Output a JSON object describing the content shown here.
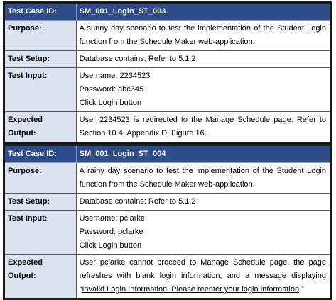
{
  "test_cases": [
    {
      "id_label": "Test Case ID:",
      "id_value": "SM_001_Login_ST_003",
      "purpose_label": "Purpose:",
      "purpose_value": "A sunny day scenario to test the implementation of the Student Login function from the Schedule Maker web-application.",
      "setup_label": "Test Setup:",
      "setup_value": "Database contains:  Refer to 5.1.2",
      "input_label": "Test Input:",
      "input_lines": [
        "Username:  2234523",
        "Password:   abc345",
        "Click Login button"
      ],
      "output_label": "Expected Output:",
      "output_value": "User 2234523 is redirected to the Manage Schedule page.  Refer to Section 10.4, Appendix D, Figure 16."
    },
    {
      "id_label": "Test Case ID:",
      "id_value": "SM_001_Login_ST_004",
      "purpose_label": "Purpose:",
      "purpose_value": "A rainy day scenario to test the implementation of the Student Login function from the Schedule Maker web-application.",
      "setup_label": "Test Setup:",
      "setup_value": "Database contains:  Refer to 5.1.2",
      "input_label": "Test Input:",
      "input_lines": [
        "Username:  pclarke",
        "Password:   pclarke",
        "Click Login button"
      ],
      "output_label": "Expected Output:",
      "output_prefix": "User pclarke cannot proceed to Manage Schedule page, the page refreshes with blank login information, and a message displaying “",
      "output_underlined": "Invalid Login Information.  Please reenter your login information",
      "output_suffix": ".”"
    }
  ]
}
